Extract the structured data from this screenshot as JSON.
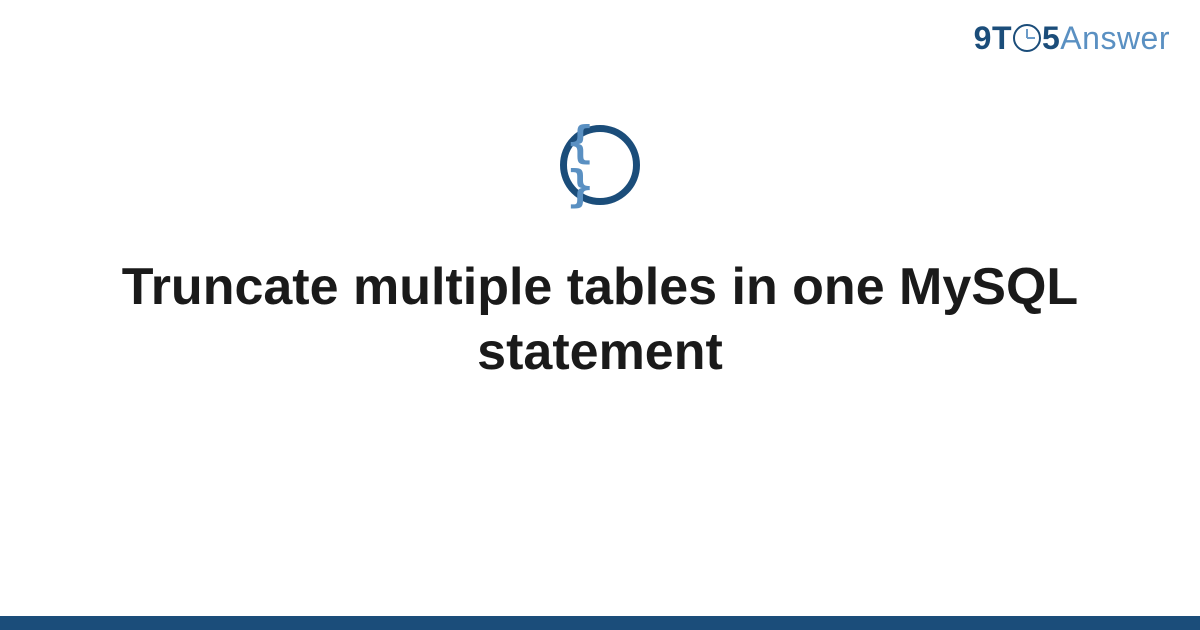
{
  "brand": {
    "prefix": "9T",
    "suffix": "5",
    "word": "Answer"
  },
  "icon": {
    "glyph": "{ }"
  },
  "title": "Truncate multiple tables in one MySQL statement"
}
